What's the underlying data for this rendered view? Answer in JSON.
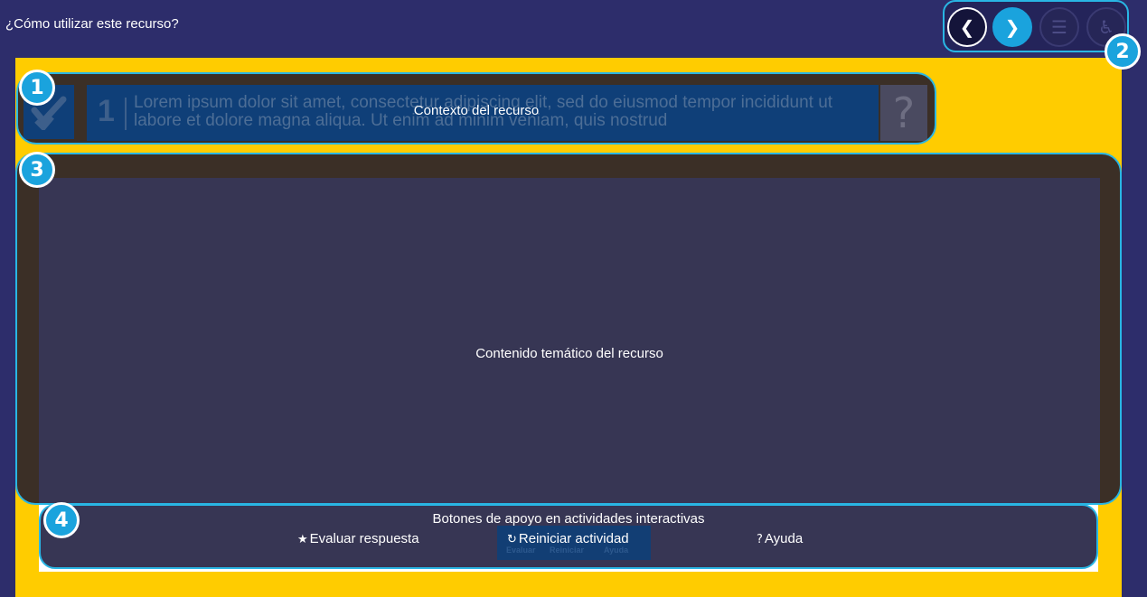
{
  "header": {
    "title": "¿Cómo utilizar este recurso?"
  },
  "nav": {
    "prev_icon": "chevron-left-icon",
    "prev_glyph": "❮",
    "next_icon": "chevron-right-icon",
    "next_glyph": "❯",
    "menu_icon": "menu-icon",
    "menu_glyph": "☰",
    "access_icon": "wheelchair-icon",
    "access_glyph": "♿"
  },
  "badges": {
    "b1": "1",
    "b2": "2",
    "b3": "3",
    "b4": "4"
  },
  "context": {
    "number": "1",
    "lorem": "Lorem ipsum dolor sit amet, consectetur adipiscing elit, sed do eiusmod tempor incididunt ut labore et dolore magna aliqua. Ut enim ad minim veniam, quis nostrud",
    "help_glyph": "?",
    "label": "Contexto del recurso"
  },
  "content": {
    "label": "Contenido temático del recurso"
  },
  "support": {
    "title": "Botones de apoyo en actividades interactivas",
    "evaluate_label": "Evaluar respuesta",
    "evaluate_glyph": "★",
    "restart_label": "Reiniciar actividad",
    "restart_glyph": "↻",
    "help_label": "Ayuda",
    "help_glyph": "?",
    "ghost_evaluate": "Evaluar",
    "ghost_restart": "Reiniciar",
    "ghost_help": "Ayuda"
  },
  "colors": {
    "background": "#2d2d6b",
    "stage": "#ffcc00",
    "accent": "#29b6e4",
    "panel": "#373654",
    "frame": "#3b2f26"
  }
}
